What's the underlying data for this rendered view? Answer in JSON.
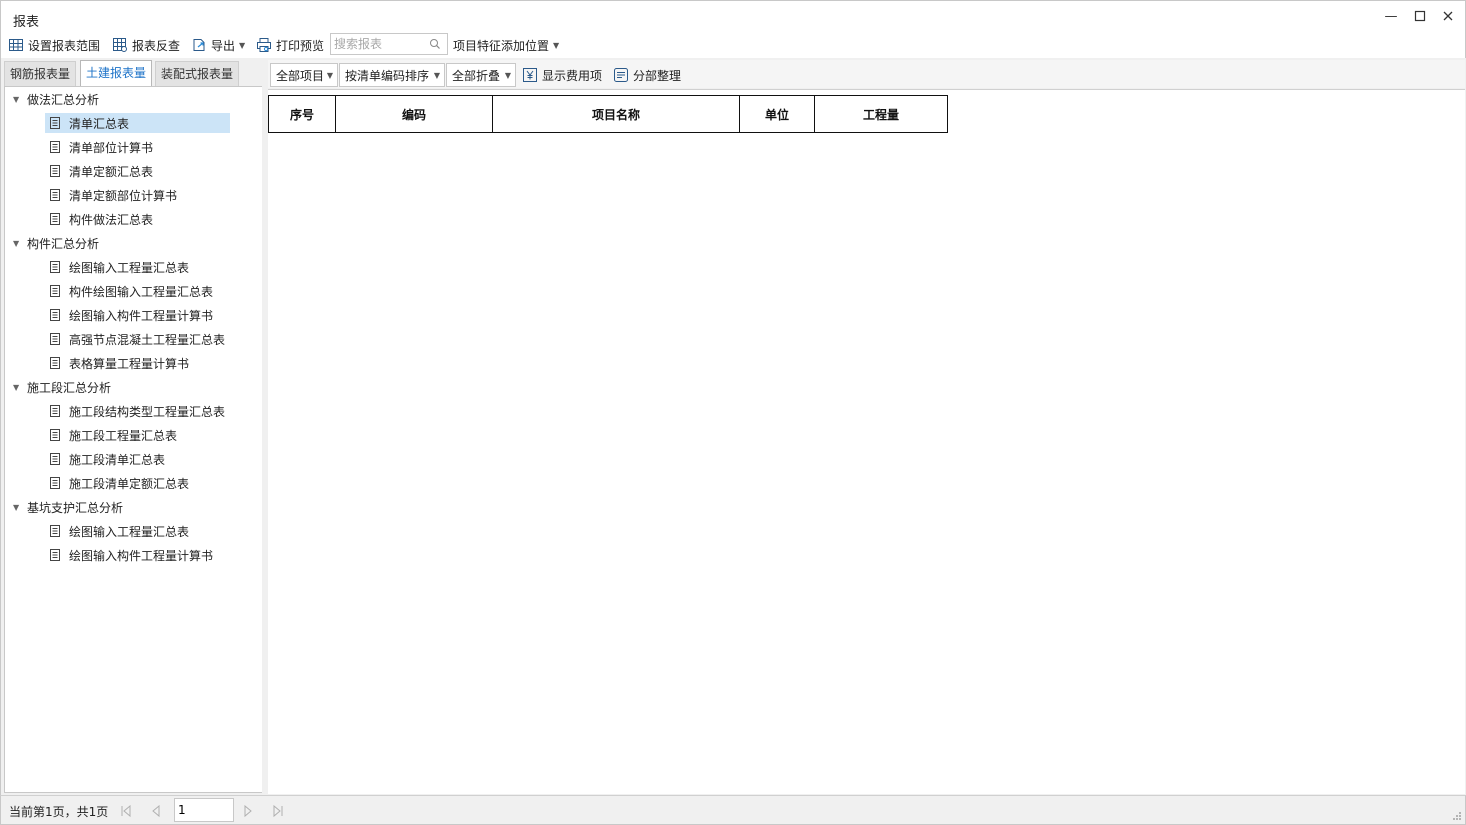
{
  "window": {
    "title": "报表"
  },
  "toolbar": {
    "set_range": "设置报表范围",
    "reverse_check": "报表反查",
    "export": "导出",
    "print_preview": "打印预览",
    "search_placeholder": "搜索报表",
    "feature_position": "项目特征添加位置"
  },
  "tabs": [
    {
      "label": "钢筋报表量",
      "active": false
    },
    {
      "label": "土建报表量",
      "active": true
    },
    {
      "label": "装配式报表量",
      "active": false
    }
  ],
  "tree": {
    "groups": [
      {
        "label": "做法汇总分析",
        "items": [
          "清单汇总表",
          "清单部位计算书",
          "清单定额汇总表",
          "清单定额部位计算书",
          "构件做法汇总表"
        ]
      },
      {
        "label": "构件汇总分析",
        "items": [
          "绘图输入工程量汇总表",
          "构件绘图输入工程量汇总表",
          "绘图输入构件工程量计算书",
          "高强节点混凝土工程量汇总表",
          "表格算量工程量计算书"
        ]
      },
      {
        "label": "施工段汇总分析",
        "items": [
          "施工段结构类型工程量汇总表",
          "施工段工程量汇总表",
          "施工段清单汇总表",
          "施工段清单定额汇总表"
        ]
      },
      {
        "label": "基坑支护汇总分析",
        "items": [
          "绘图输入工程量汇总表",
          "绘图输入构件工程量计算书"
        ]
      }
    ],
    "selected": "清单汇总表"
  },
  "report_toolbar": {
    "filter_all": "全部项目",
    "sort_by_code": "按清单编码排序",
    "collapse_all": "全部折叠",
    "show_fee": "显示费用项",
    "section_tidy": "分部整理"
  },
  "table": {
    "headers": [
      "序号",
      "编码",
      "项目名称",
      "单位",
      "工程量"
    ]
  },
  "status": {
    "page_info": "当前第1页，共1页",
    "page_value": "1"
  }
}
